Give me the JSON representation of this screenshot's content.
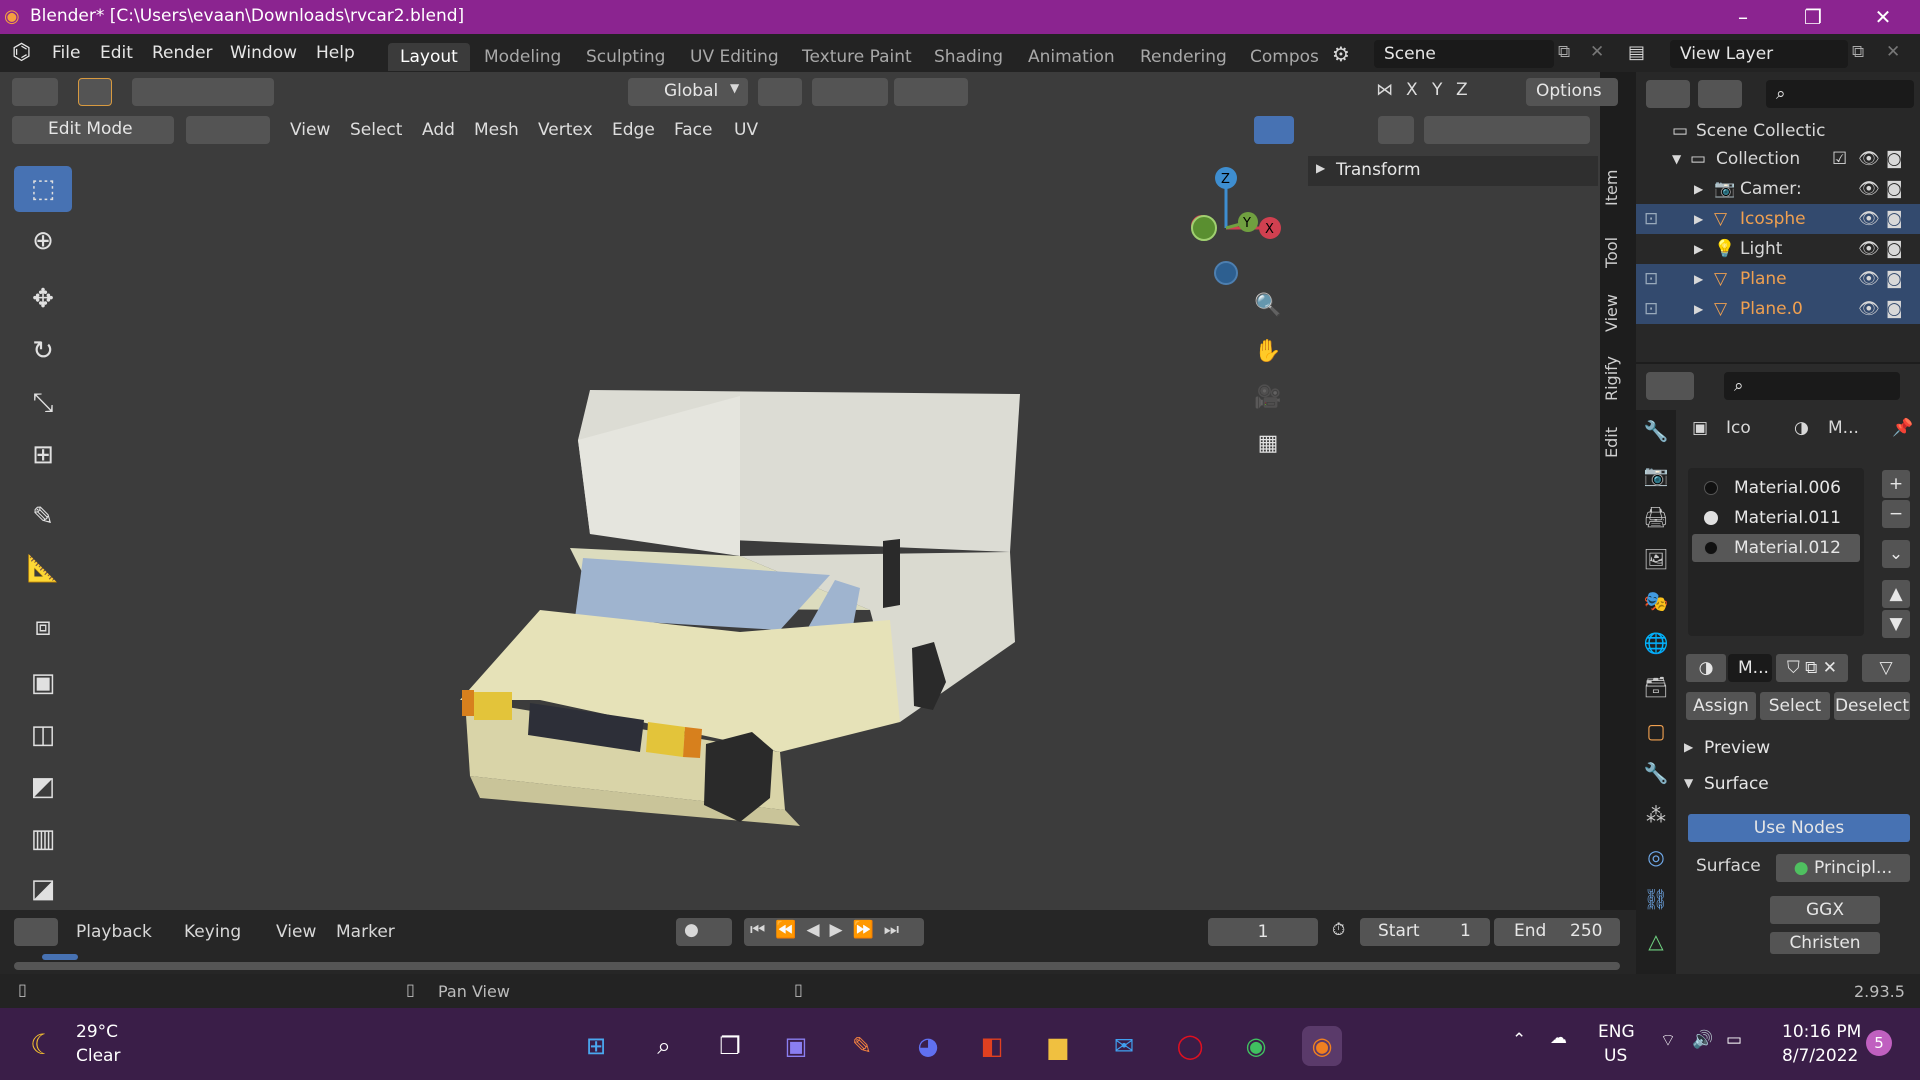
{
  "window": {
    "title": "Blender* [C:\\Users\\evaan\\Downloads\\rvcar2.blend]",
    "minimize": "–",
    "maximize": "❐",
    "close": "✕"
  },
  "menu": [
    "File",
    "Edit",
    "Render",
    "Window",
    "Help"
  ],
  "workspaces": [
    "Layout",
    "Modeling",
    "Sculpting",
    "UV Editing",
    "Texture Paint",
    "Shading",
    "Animation",
    "Rendering",
    "Compos"
  ],
  "scene": {
    "name": "Scene"
  },
  "view_layer": {
    "name": "View Layer"
  },
  "viewport": {
    "transform_orientation": "Global",
    "options_label": "Options",
    "axes": [
      "X",
      "Y",
      "Z"
    ],
    "mode": "Edit Mode",
    "menus": [
      "View",
      "Select",
      "Add",
      "Mesh",
      "Vertex",
      "Edge",
      "Face",
      "UV"
    ],
    "transform_panel": "Transform",
    "sidetabs": [
      "Item",
      "Tool",
      "View",
      "Rigify",
      "Edit"
    ],
    "gizmo": {
      "x": "X",
      "y": "Y",
      "z": "Z"
    }
  },
  "outliner": {
    "root": "Scene Collectic",
    "collection": "Collection",
    "items": [
      {
        "label": "Camer:",
        "sel": false,
        "color": "#e0e0e0"
      },
      {
        "label": "Icosphe",
        "sel": true,
        "color": "#f0a050"
      },
      {
        "label": "Light",
        "sel": false,
        "color": "#e0e0e0"
      },
      {
        "label": "Plane",
        "sel": true,
        "color": "#f0a050"
      },
      {
        "label": "Plane.0",
        "sel": true,
        "color": "#f0a050"
      }
    ]
  },
  "properties": {
    "object_short": "Ico",
    "material_short": "M...",
    "materials": [
      {
        "name": "Material.006",
        "sel": false,
        "dot": "#111111"
      },
      {
        "name": "Material.011",
        "sel": false,
        "dot": "#e0e0e0"
      },
      {
        "name": "Material.012",
        "sel": true,
        "dot": "#111111"
      }
    ],
    "mat_field": "M...",
    "assign": "Assign",
    "select": "Select",
    "deselect": "Deselect",
    "preview": "Preview",
    "surface_section": "Surface",
    "use_nodes": "Use Nodes",
    "surface_label": "Surface",
    "surface_value": "Principl...",
    "ggx": "GGX",
    "christen": "Christen"
  },
  "timeline": {
    "menus": [
      "Playback",
      "Keying",
      "View",
      "Marker"
    ],
    "current_frame": "1",
    "start_label": "Start",
    "start_value": "1",
    "end_label": "End",
    "end_value": "250"
  },
  "status": {
    "hint": "Pan View",
    "version": "2.93.5"
  },
  "taskbar": {
    "weather_temp": "29°C",
    "weather_desc": "Clear",
    "lang": "ENG",
    "region": "US",
    "time": "10:16 PM",
    "date": "8/7/2022",
    "notif_count": "5"
  }
}
